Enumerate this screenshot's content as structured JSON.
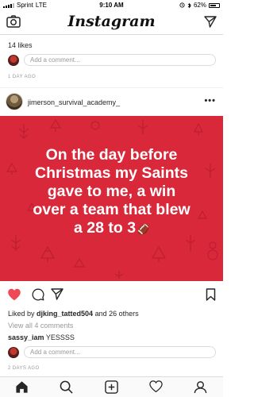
{
  "status_bar": {
    "carrier": "Sprint",
    "network": "LTE",
    "time": "9:10 AM",
    "battery": "62%",
    "icons": [
      "signal-icon",
      "alarm-icon",
      "bluetooth-icon",
      "battery-icon"
    ]
  },
  "top_nav": {
    "logo": "Instagram",
    "left_icon": "camera-icon",
    "right_icon": "direct-message-icon"
  },
  "previous_post": {
    "likes": "14 likes",
    "comment_placeholder": "Add a comment...",
    "timestamp": "1 DAY AGO"
  },
  "post": {
    "username": "jimerson_survival_academy_",
    "more_label": "•••",
    "image_text_lines": [
      "On the day before",
      "Christmas my Saints",
      "gave to me, a win",
      "over a team that blew",
      "a 28 to 3"
    ],
    "image_emoji": "🏈",
    "image_bg_color": "#d9283a",
    "liked_by_prefix": "Liked by",
    "liked_by_user": "djking_tatted504",
    "liked_by_suffix": "and 26 others",
    "view_all_comments": "View all 4 comments",
    "comments": [
      {
        "user": "sassy_iam",
        "text": "YESSSS"
      }
    ],
    "comment_placeholder": "Add a comment...",
    "timestamp": "2 DAYS AGO",
    "liked": true,
    "like_color": "#ed4956"
  },
  "tab_bar": {
    "tabs": [
      "home-icon",
      "search-icon",
      "new-post-icon",
      "activity-icon",
      "profile-icon"
    ]
  }
}
